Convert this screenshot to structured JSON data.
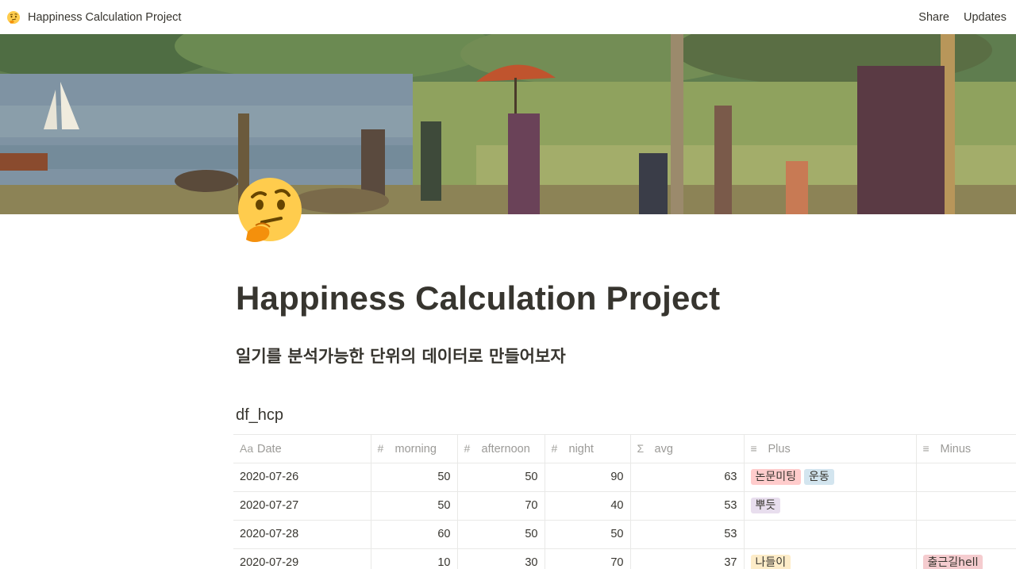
{
  "topbar": {
    "page_name": "Happiness Calculation Project",
    "share_label": "Share",
    "updates_label": "Updates"
  },
  "page": {
    "title": "Happiness Calculation Project",
    "subtitle": "일기를 분석가능한 단위의 데이터로 만들어보자",
    "icon": "thinking-face-icon"
  },
  "database": {
    "title": "df_hcp",
    "columns": [
      {
        "label": "Date",
        "icon": "Aa"
      },
      {
        "label": "morning",
        "icon": "#"
      },
      {
        "label": "afternoon",
        "icon": "#"
      },
      {
        "label": "night",
        "icon": "#"
      },
      {
        "label": "avg",
        "icon": "Σ"
      },
      {
        "label": "Plus",
        "icon": "≡"
      },
      {
        "label": "Minus",
        "icon": "≡"
      }
    ],
    "rows": [
      {
        "date": "2020-07-26",
        "morning": "50",
        "afternoon": "50",
        "night": "90",
        "avg": "63",
        "plus": [
          {
            "text": "논문미팅",
            "color": "#ffcccc"
          },
          {
            "text": "운동",
            "color": "#d3e5ef"
          }
        ],
        "minus": []
      },
      {
        "date": "2020-07-27",
        "morning": "50",
        "afternoon": "70",
        "night": "40",
        "avg": "53",
        "plus": [
          {
            "text": "뿌듯",
            "color": "#e8deee"
          }
        ],
        "minus": []
      },
      {
        "date": "2020-07-28",
        "morning": "60",
        "afternoon": "50",
        "night": "50",
        "avg": "53",
        "plus": [],
        "minus": []
      },
      {
        "date": "2020-07-29",
        "morning": "10",
        "afternoon": "30",
        "night": "70",
        "avg": "37",
        "plus": [
          {
            "text": "나들이",
            "color": "#fdecc8"
          }
        ],
        "minus": [
          {
            "text": "출근길hell",
            "color": "#f5cccf"
          }
        ]
      }
    ]
  }
}
